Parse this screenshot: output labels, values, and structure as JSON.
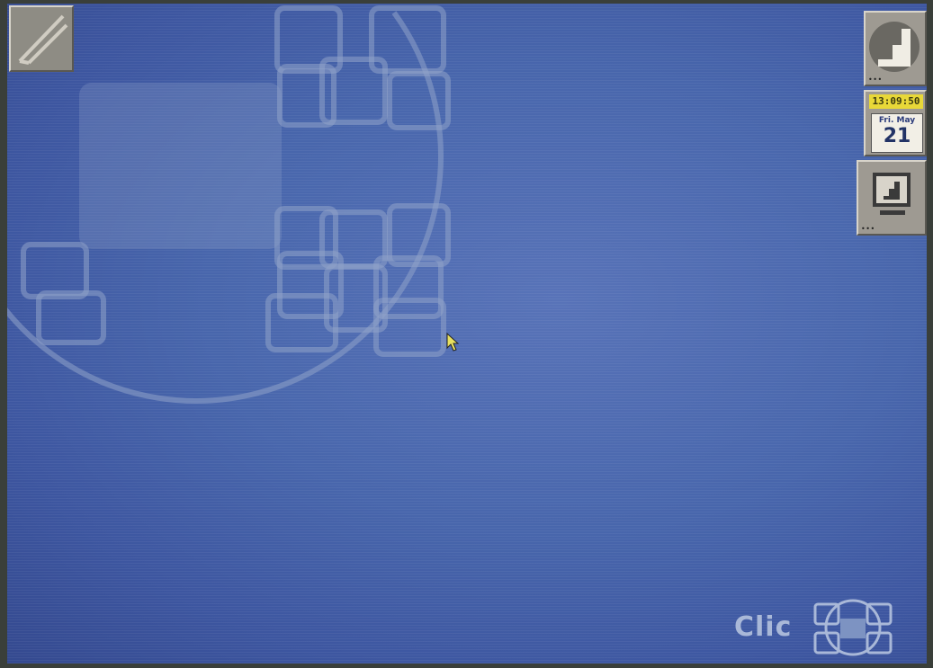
{
  "desktop": {
    "clock": {
      "time": "13:09:50",
      "weekday_month": "Fri. May",
      "day": "21"
    },
    "brand": {
      "text": "Clic"
    },
    "icons": {
      "top_left": "pencil-icon",
      "top_right": "exit-icon",
      "monitor": "monitor-icon",
      "logo": "clic-logo-icon",
      "cursor": "mouse-pointer-icon"
    },
    "colors": {
      "desktop_bg": "#4866ac",
      "dock_gray": "#9e9a92",
      "clock_yellow": "#e8d838",
      "wallpaper_pattern": "#8fa3c9"
    }
  }
}
